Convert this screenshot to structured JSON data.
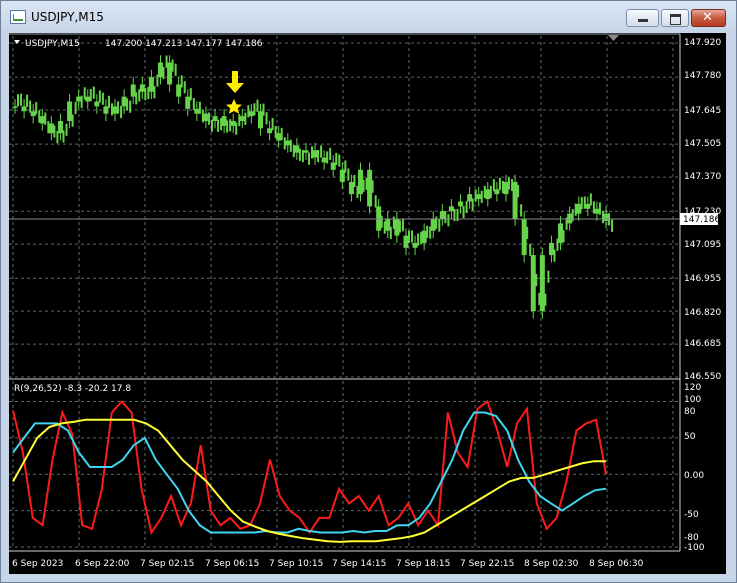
{
  "window": {
    "title": "USDJPY,M15"
  },
  "header": {
    "symbol": "USDJPY,M15",
    "ohlc": "147.200 147.213 147.177 147.186"
  },
  "price_axis": {
    "ticks": [
      "147.920",
      "147.780",
      "147.645",
      "147.505",
      "147.370",
      "147.230",
      "147.095",
      "146.955",
      "146.820",
      "146.685",
      "146.550"
    ],
    "current_price": "147.186"
  },
  "indicator": {
    "label": "R(9,26,52) -8.3 -20.2 17.8",
    "ticks": [
      "120",
      "100",
      "80",
      "50",
      "0.00",
      "-50",
      "-80",
      "-100"
    ]
  },
  "time_axis": {
    "labels": [
      "6 Sep 2023",
      "6 Sep 22:00",
      "7 Sep 02:15",
      "7 Sep 06:15",
      "7 Sep 10:15",
      "7 Sep 14:15",
      "7 Sep 18:15",
      "7 Sep 22:15",
      "8 Sep 02:30",
      "8 Sep 06:30"
    ]
  },
  "colors": {
    "candle": "#66d44a",
    "red_line": "#ff1a1a",
    "cyan_line": "#3fd6f0",
    "yellow_line": "#ffff33",
    "marker": "#ffee00",
    "grid": "#5a6a6a"
  },
  "chart_data": [
    {
      "type": "line",
      "title": "USDJPY,M15",
      "ylim": [
        146.55,
        147.92
      ],
      "y_ticks": [
        147.92,
        147.78,
        147.645,
        147.505,
        147.37,
        147.23,
        147.095,
        146.955,
        146.82,
        146.685,
        146.55
      ],
      "series": [
        {
          "name": "USDJPY,M15",
          "values": [
            147.66,
            147.64,
            147.62,
            147.59,
            147.55,
            147.6,
            147.68,
            147.7,
            147.68,
            147.66,
            147.63,
            147.66,
            147.7,
            147.75,
            147.72,
            147.78,
            147.84,
            147.75,
            147.7,
            147.65,
            147.63,
            147.6,
            147.62,
            147.58,
            147.6,
            147.62,
            147.64,
            147.57,
            147.55,
            147.52,
            147.5,
            147.47,
            147.48,
            147.45,
            147.43,
            147.4,
            147.35,
            147.3,
            147.4,
            147.25,
            147.15,
            147.2,
            147.13,
            147.08,
            147.1,
            147.15,
            147.2,
            147.23,
            147.25,
            147.27,
            147.3,
            147.28,
            147.32,
            147.3,
            147.35,
            147.2,
            147.05,
            146.82,
            147.05,
            147.1,
            147.18,
            147.22,
            147.26,
            147.24,
            147.22,
            147.19
          ]
        }
      ],
      "current_price": 147.186
    },
    {
      "type": "line",
      "title": "R(9,26,52)",
      "ylim": [
        -100,
        120
      ],
      "y_ticks": [
        120,
        100,
        80,
        50,
        0,
        -50,
        -80,
        -100
      ],
      "last_values": [
        -8.3,
        -20.2,
        17.8
      ],
      "series": [
        {
          "name": "R(9,26,52)",
          "values": [
            88,
            30,
            -60,
            -70,
            20,
            85,
            55,
            -70,
            -75,
            -20,
            85,
            100,
            85,
            -20,
            -80,
            -60,
            -30,
            -70,
            -40,
            40,
            -50,
            -70,
            -60,
            -75,
            -70,
            -40,
            20,
            -30,
            -50,
            -60,
            -80,
            -60,
            -60,
            -20,
            -40,
            -30,
            -50,
            -30,
            -70,
            -60,
            -40,
            -70,
            -50,
            -70,
            85,
            30,
            10,
            90,
            100,
            60,
            10,
            70,
            90,
            -40,
            -75,
            -60,
            -10,
            60,
            70,
            75,
            0
          ]
        },
        {
          "name": "R(9,26,52)",
          "values": [
            30,
            50,
            70,
            70,
            70,
            60,
            30,
            10,
            10,
            10,
            20,
            40,
            50,
            20,
            0,
            -20,
            -50,
            -70,
            -80,
            -80,
            -80,
            -80,
            -80,
            -78,
            -80,
            -80,
            -75,
            -78,
            -80,
            -80,
            -80,
            -78,
            -80,
            -78,
            -78,
            -70,
            -70,
            -60,
            -40,
            -10,
            20,
            60,
            85,
            85,
            80,
            60,
            20,
            -10,
            -30,
            -40,
            -50,
            -40,
            -30,
            -22,
            -20
          ]
        },
        {
          "name": "R(9,26,52)",
          "values": [
            -10,
            20,
            50,
            65,
            70,
            72,
            75,
            75,
            75,
            75,
            75,
            70,
            60,
            40,
            20,
            5,
            -10,
            -30,
            -50,
            -65,
            -72,
            -78,
            -82,
            -85,
            -88,
            -90,
            -92,
            -93,
            -92,
            -92,
            -92,
            -90,
            -88,
            -85,
            -80,
            -70,
            -60,
            -50,
            -40,
            -30,
            -20,
            -10,
            -5,
            -5,
            0,
            5,
            10,
            15,
            18,
            18
          ]
        }
      ]
    }
  ]
}
